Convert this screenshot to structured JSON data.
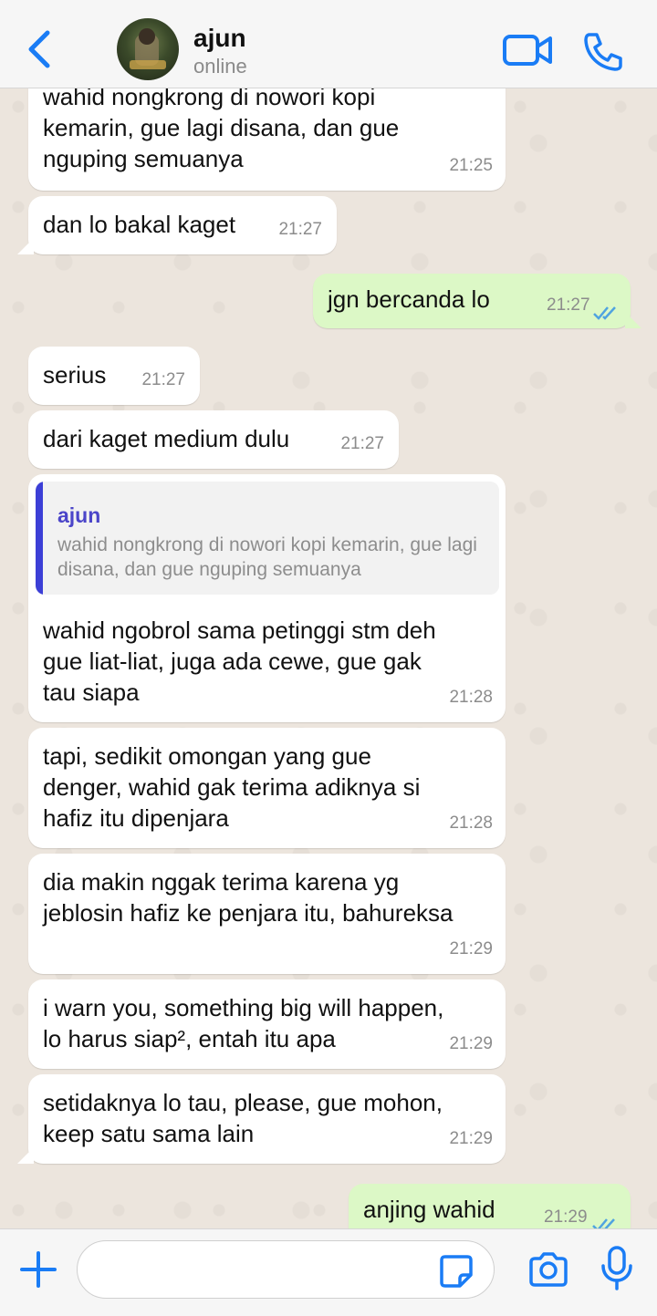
{
  "header": {
    "contact_name": "ajun",
    "status": "online",
    "icons": {
      "back": "chevron-left-icon",
      "video": "video-camera-icon",
      "call": "phone-icon"
    },
    "accent_color": "#1a7cf5"
  },
  "messages": [
    {
      "type": "in",
      "text": "wahid nongkrong di nowori kopi\nkemarin, gue lagi disana, dan gue\nnguping semuanya",
      "time": "21:25"
    },
    {
      "type": "in",
      "text": "dan lo bakal kaget",
      "time": "21:27"
    },
    {
      "type": "out",
      "text": "jgn bercanda lo",
      "time": "21:27",
      "status": "read"
    },
    {
      "type": "in",
      "text": "serius",
      "time": "21:27"
    },
    {
      "type": "in",
      "text": "dari kaget medium dulu",
      "time": "21:27"
    },
    {
      "type": "in",
      "reply": {
        "name": "ajun",
        "text": "wahid nongkrong di nowori kopi kemarin, gue lagi disana, dan gue nguping semuanya"
      },
      "text": "wahid ngobrol sama petinggi stm deh\ngue liat-liat, juga ada cewe, gue gak\ntau siapa",
      "time": "21:28"
    },
    {
      "type": "in",
      "text": "tapi, sedikit omongan yang gue\ndenger, wahid gak terima adiknya si\nhafiz itu dipenjara",
      "time": "21:28"
    },
    {
      "type": "in",
      "text": "dia makin nggak terima karena yg\njeblosin hafiz ke penjara itu, bahureksa",
      "time": "21:29"
    },
    {
      "type": "in",
      "text": "i warn you, something big will happen,\nlo harus siap², entah itu apa",
      "time": "21:29"
    },
    {
      "type": "in",
      "text": "setidaknya lo tau, please, gue mohon,\nkeep satu sama lain",
      "time": "21:29"
    },
    {
      "type": "out",
      "text": "anjing wahid",
      "time": "21:29",
      "status": "read"
    }
  ],
  "footer": {
    "input_value": "",
    "icons": {
      "plus": "plus-icon",
      "sticker": "sticker-icon",
      "camera": "camera-icon",
      "mic": "microphone-icon"
    }
  },
  "colors": {
    "incoming_bubble": "#ffffff",
    "outgoing_bubble": "#dcf8c6",
    "read_ticks": "#4fa3e0",
    "chat_background": "#ece5dd"
  }
}
